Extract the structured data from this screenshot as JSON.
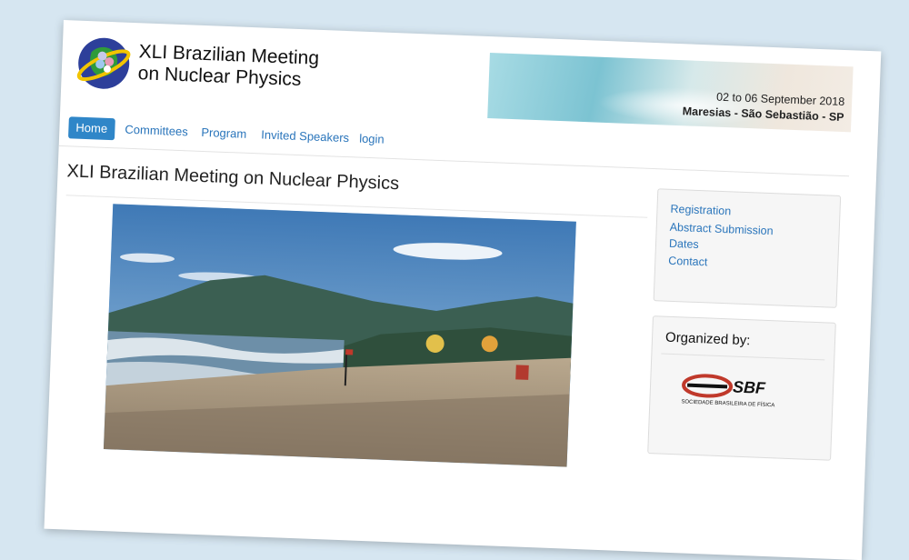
{
  "header": {
    "title_line1": "XLI Brazilian Meeting",
    "title_line2": "on Nuclear Physics",
    "logo_icon": "globe-atom-logo-icon",
    "banner": {
      "date": "02 to 06 September 2018",
      "place": "Maresias - São Sebastião - SP"
    }
  },
  "nav": {
    "items": [
      "Home",
      "Committees",
      "Program",
      "Invited Speakers",
      "login"
    ],
    "active": "Home"
  },
  "main": {
    "title": "XLI Brazilian Meeting on Nuclear Physics",
    "photo": "beach-photo"
  },
  "sidebar": {
    "links": [
      "Registration",
      "Abstract Submission",
      "Dates",
      "Contact"
    ]
  },
  "organizer": {
    "title": "Organized by:",
    "logo_text": "SBF",
    "logo_subtext": "SOCIEDADE BRASILEIRA DE FÍSICA"
  },
  "colors": {
    "accent": "#2f86c8",
    "link": "#2a75bb",
    "background": "#d6e6f1"
  }
}
